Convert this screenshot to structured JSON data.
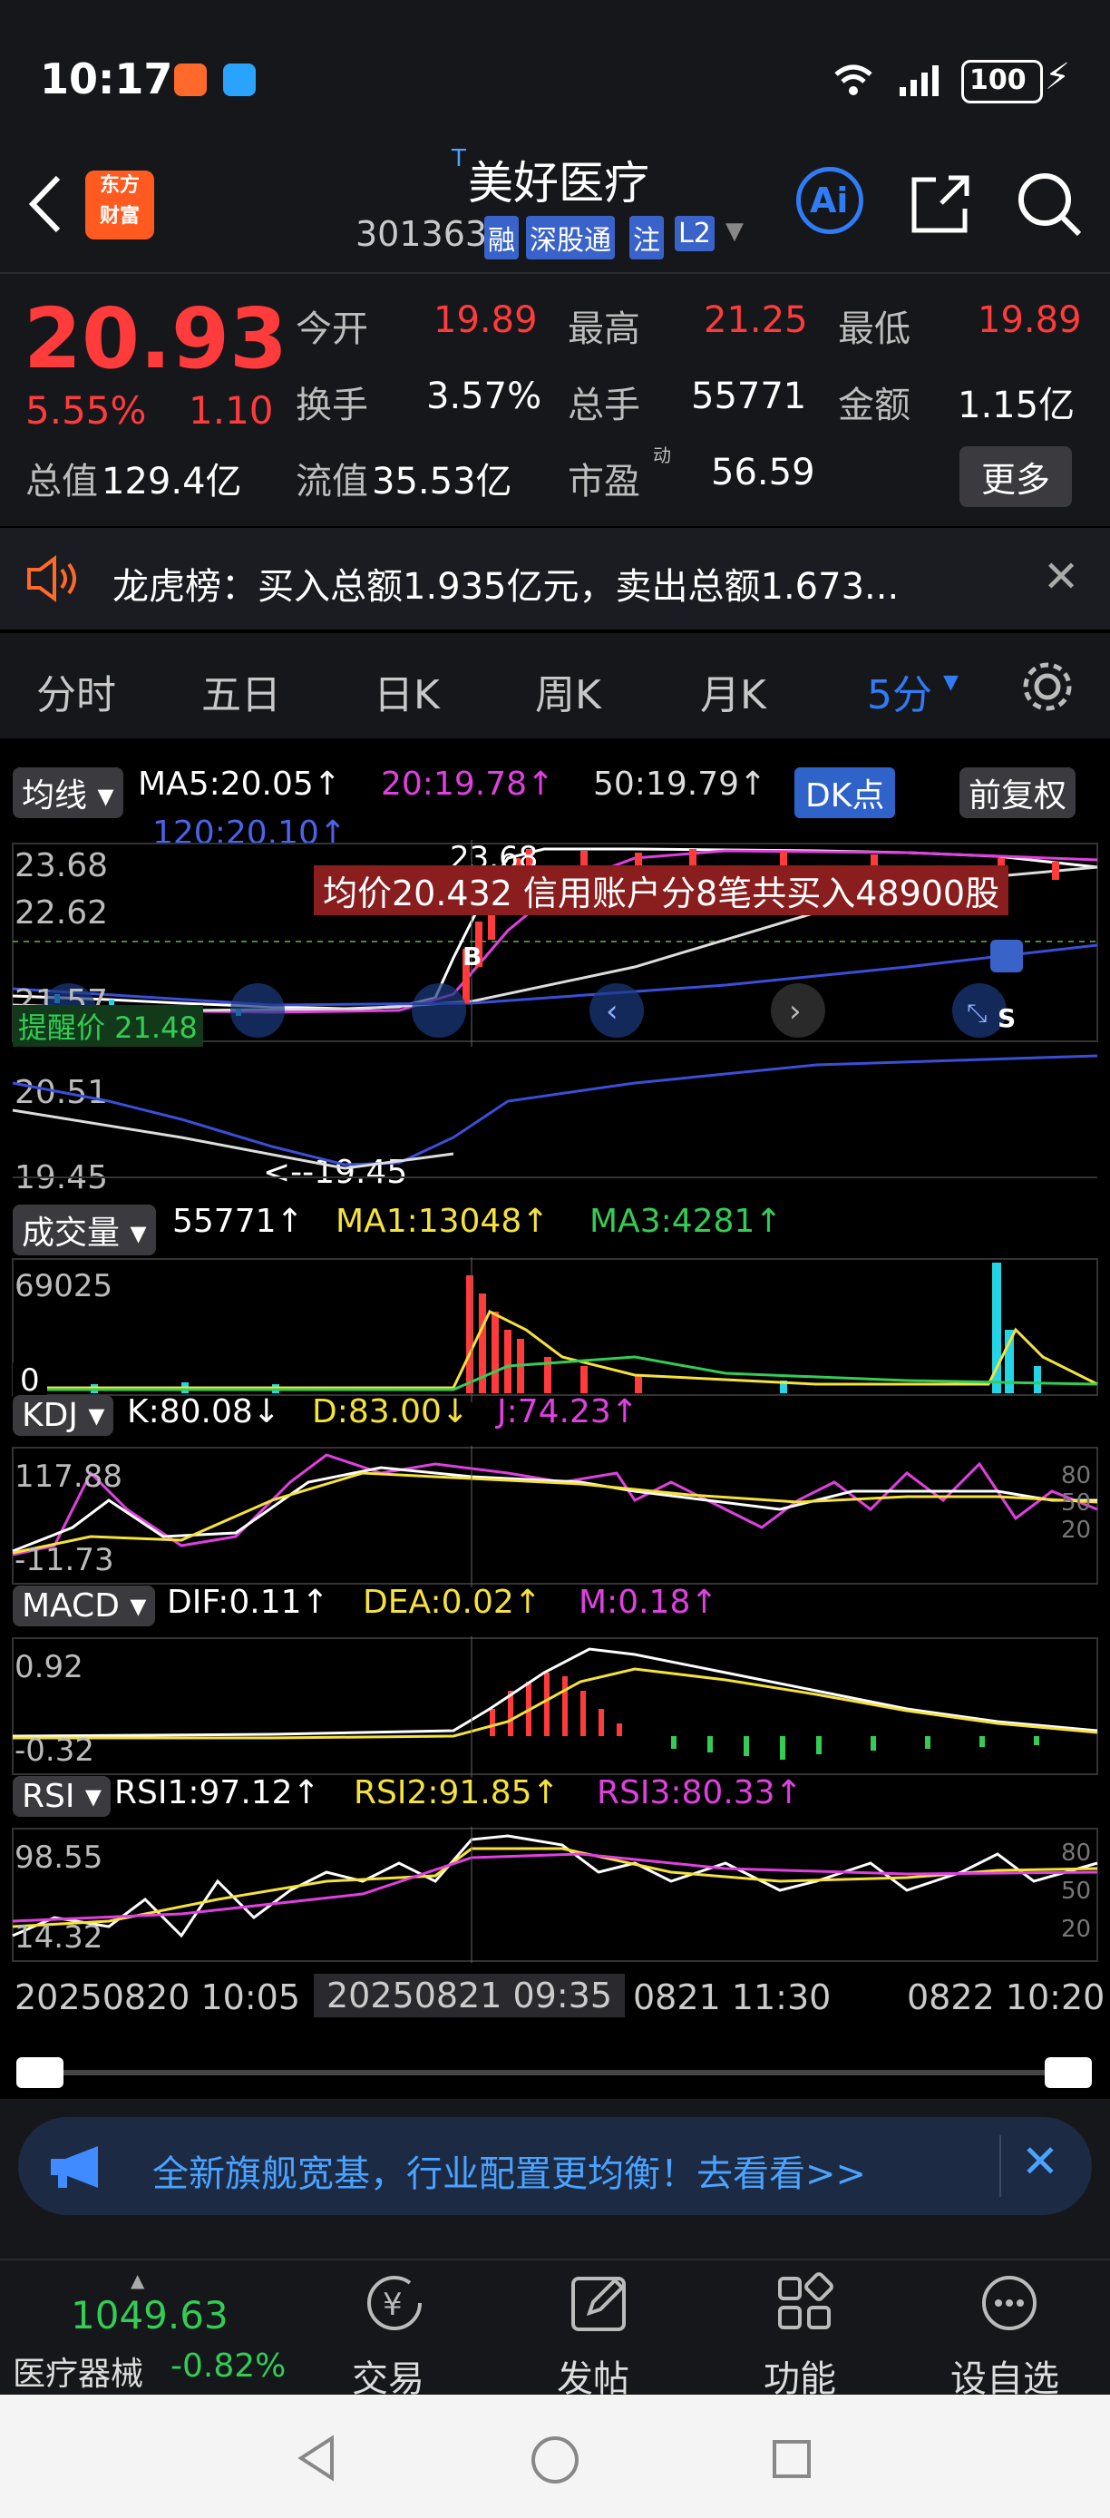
{
  "status_bar": {
    "time": "10:17",
    "battery": "100"
  },
  "header": {
    "title_prefix": "T",
    "title": "美好医疗",
    "code": "301363",
    "badges": [
      "融",
      "深股通",
      "注",
      "L2"
    ],
    "ai_label": "Ai"
  },
  "quote": {
    "price": "20.93",
    "change_pct": "5.55%",
    "change": "1.10",
    "fields": [
      {
        "label": "今开",
        "value": "19.89"
      },
      {
        "label": "最高",
        "value": "21.25"
      },
      {
        "label": "最低",
        "value": "19.89"
      },
      {
        "label": "换手",
        "value": "3.57%"
      },
      {
        "label": "总手",
        "value": "55771"
      },
      {
        "label": "金额",
        "value": "1.15亿"
      },
      {
        "label": "总值",
        "value": "129.4亿"
      },
      {
        "label": "流值",
        "value": "35.53亿"
      },
      {
        "label": "市盈",
        "value": "56.59",
        "sup": "动"
      }
    ],
    "more_label": "更多"
  },
  "notice": {
    "text": "龙虎榜：买入总额1.935亿元，卖出总额1.673..."
  },
  "tabs": {
    "items": [
      "分时",
      "五日",
      "日K",
      "周K",
      "月K"
    ],
    "active": "5分"
  },
  "chart_toolbar": {
    "ma_selector": "均线",
    "ma5": "MA5:20.05↑",
    "ma20": "20:19.78↑",
    "ma50": "50:19.79↑",
    "ma120": "120:20.10↑",
    "dk_label": "DK点",
    "adjust_label": "前复权"
  },
  "colors": {
    "up": "#ff3b3b",
    "down": "#22d6e8",
    "ma5": "#ffffff",
    "ma20": "#e040e0",
    "ma50": "#dddddd",
    "ma120": "#3a4fd8",
    "yellow": "#f5e23a",
    "green": "#33cc55"
  },
  "candle_panel": {
    "y_labels": [
      "23.68",
      "22.62",
      "21.57",
      "20.51",
      "19.45"
    ],
    "high_marker": "23.68",
    "low_marker": "19.45",
    "alert_label": "提醒价 21.48",
    "banner": "均价20.432  信用账户分8笔共买入48900股",
    "buy_marker": "B",
    "sell_marker": "S"
  },
  "volume_panel": {
    "selector": "成交量",
    "value": "55771↑",
    "ma1": "MA1:13048↑",
    "ma3": "MA3:4281↑",
    "y_top": "69025",
    "y_bottom": "0"
  },
  "kdj_panel": {
    "selector": "KDJ",
    "k": "K:80.08↓",
    "d": "D:83.00↓",
    "j": "J:74.23↑",
    "y_top": "117.88",
    "y_bottom": "-11.73",
    "right_labels": [
      "80",
      "50",
      "20"
    ]
  },
  "macd_panel": {
    "selector": "MACD",
    "dif": "DIF:0.11↑",
    "dea": "DEA:0.02↑",
    "m": "M:0.18↑",
    "y_top": "0.92",
    "y_bottom": "-0.32"
  },
  "rsi_panel": {
    "selector": "RSI",
    "rsi1": "RSI1:97.12↑",
    "rsi2": "RSI2:91.85↑",
    "rsi3": "RSI3:80.33↑",
    "y_top": "98.55",
    "y_bottom": "14.32",
    "right_labels": [
      "80",
      "50",
      "20"
    ]
  },
  "time_axis": [
    "20250820 10:05",
    "20250821 09:35",
    "0821 11:30",
    "0822 10:20"
  ],
  "ad_banner": {
    "text": "全新旗舰宽基，行业配置更均衡！去看看>>"
  },
  "bottom_nav": {
    "index_value": "1049.63",
    "index_name": "医疗器械",
    "index_change": "-0.82%",
    "items": [
      "交易",
      "发帖",
      "功能",
      "设自选"
    ]
  }
}
